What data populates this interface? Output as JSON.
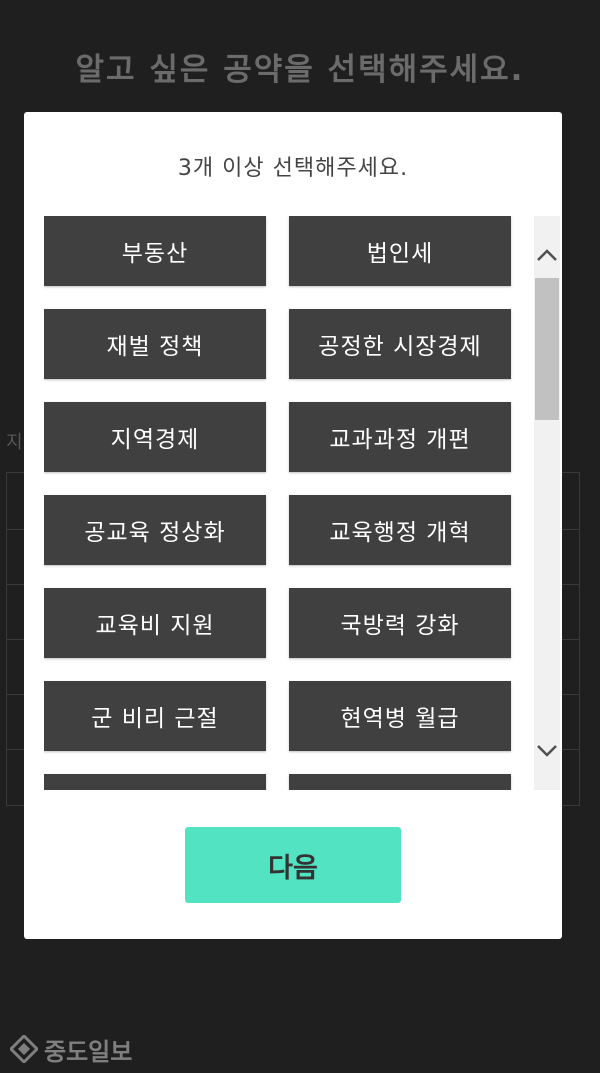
{
  "page": {
    "title": "알고 싶은 공약을 선택해주세요.",
    "background_label": "지"
  },
  "modal": {
    "subtitle": "3개 이상 선택해주세요.",
    "options": [
      "부동산",
      "법인세",
      "재벌 정책",
      "공정한 시장경제",
      "지역경제",
      "교과과정 개편",
      "공교육 정상화",
      "교육행정 개혁",
      "교육비 지원",
      "국방력 강화",
      "군 비리 근절",
      "현역병 월급",
      "",
      ""
    ],
    "next_label": "다음"
  },
  "watermark": {
    "text": "중도일보"
  },
  "colors": {
    "background": "#1f1f1f",
    "option": "#404040",
    "accent": "#52e3c2"
  }
}
